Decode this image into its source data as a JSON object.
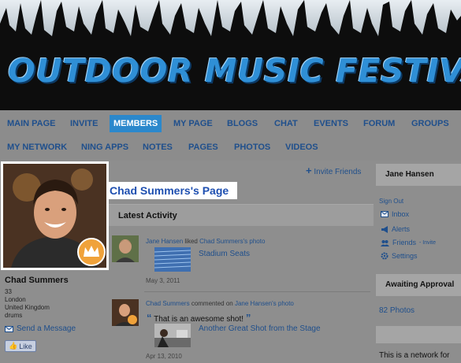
{
  "banner": {
    "title": "OUTDOOR MUSIC FESTIVALS"
  },
  "nav": {
    "row1": [
      "MAIN PAGE",
      "INVITE",
      "MEMBERS",
      "MY PAGE",
      "BLOGS",
      "CHAT",
      "EVENTS",
      "FORUM",
      "GROUPS"
    ],
    "row2": [
      "MY NETWORK",
      "NING APPS",
      "NOTES",
      "PAGES",
      "PHOTOS",
      "VIDEOS"
    ],
    "active": "MEMBERS"
  },
  "profile": {
    "name": "Chad Summers",
    "age": "33",
    "city": "London",
    "country": "United Kingdom",
    "interest": "drums",
    "send_message": "Send a Message",
    "like": "Like"
  },
  "main": {
    "invite_friends": "Invite Friends",
    "page_title": "Chad Summers's Page",
    "activity_header": "Latest Activity",
    "activities": [
      {
        "actor": "Jane Hansen",
        "verb": "liked",
        "target": "Chad Summers's photo",
        "item": "Stadium Seats",
        "date": "May 3, 2011"
      },
      {
        "actor": "Chad Summers",
        "verb": "commented on",
        "target": "Jane Hansen's photo",
        "comment": "That is an awesome shot!",
        "item": "Another Great Shot from the Stage",
        "date": "Apr 13, 2010"
      }
    ]
  },
  "sidebar": {
    "user": "Jane Hansen",
    "sign_out": "Sign Out",
    "links": [
      {
        "label": "Inbox",
        "icon": "envelope-icon"
      },
      {
        "label": "Alerts",
        "icon": "megaphone-icon"
      },
      {
        "label": "Friends",
        "sub": "- Invite",
        "icon": "friends-icon"
      },
      {
        "label": "Settings",
        "icon": "gear-icon"
      }
    ],
    "approval_header": "Awaiting Approval",
    "photos_link": "82 Photos",
    "network_text": "This is a network for"
  },
  "colors": {
    "link": "#1f4f8c",
    "nav_active": "#2b88cc",
    "title_blue": "#1e4fb0",
    "banner_text": "#2f8fd6"
  }
}
